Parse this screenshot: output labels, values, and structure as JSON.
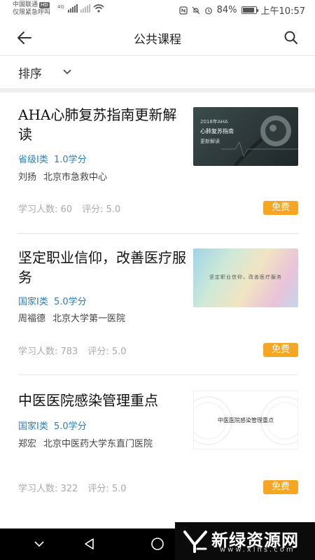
{
  "status_bar": {
    "carrier_line1": "中国联通",
    "hd_badge": "HD",
    "carrier_line2": "仅限紧急呼叫",
    "network_4g": "4G",
    "battery": "84%",
    "time": "上午10:57"
  },
  "header": {
    "title": "公共课程"
  },
  "sort": {
    "label": "排序"
  },
  "courses": [
    {
      "title": "AHA心肺复苏指南更新解读",
      "level": "省级I类",
      "credit": "1.0学分",
      "author": "刘扬",
      "institution": "北京市急救中心",
      "learners": "学习人数: 60",
      "rating": "评分: 5.0",
      "badge": "免费",
      "thumb_line1": "2018年AHA",
      "thumb_line2": "心肺复苏指南",
      "thumb_line3": "更新解读"
    },
    {
      "title": "坚定职业信仰，改善医疗服务",
      "level": "国家I类",
      "credit": "5.0学分",
      "author": "周福德",
      "institution": "北京大学第一医院",
      "learners": "学习人数: 783",
      "rating": "评分: 5.0",
      "badge": "免费",
      "thumb_text": "坚定职业信仰，改善医疗服务"
    },
    {
      "title": "中医医院感染管理重点",
      "level": "国家I类",
      "credit": "5.0学分",
      "author": "郑宏",
      "institution": "北京中医药大学东直门医院",
      "learners": "学习人数: 322",
      "rating": "评分: 5.0",
      "badge": "免费",
      "thumb_text": "中医医院感染管理重点"
    }
  ],
  "watermark": {
    "name": "新绿资源网",
    "url": "www.xlhs.com"
  },
  "colors": {
    "accent_blue": "#2a7fb8",
    "badge_orange": "#f5a623"
  },
  "icons": [
    "back-arrow-icon",
    "search-icon",
    "chevron-down-icon",
    "nav-back-icon",
    "nav-home-icon",
    "nav-recent-icon"
  ]
}
